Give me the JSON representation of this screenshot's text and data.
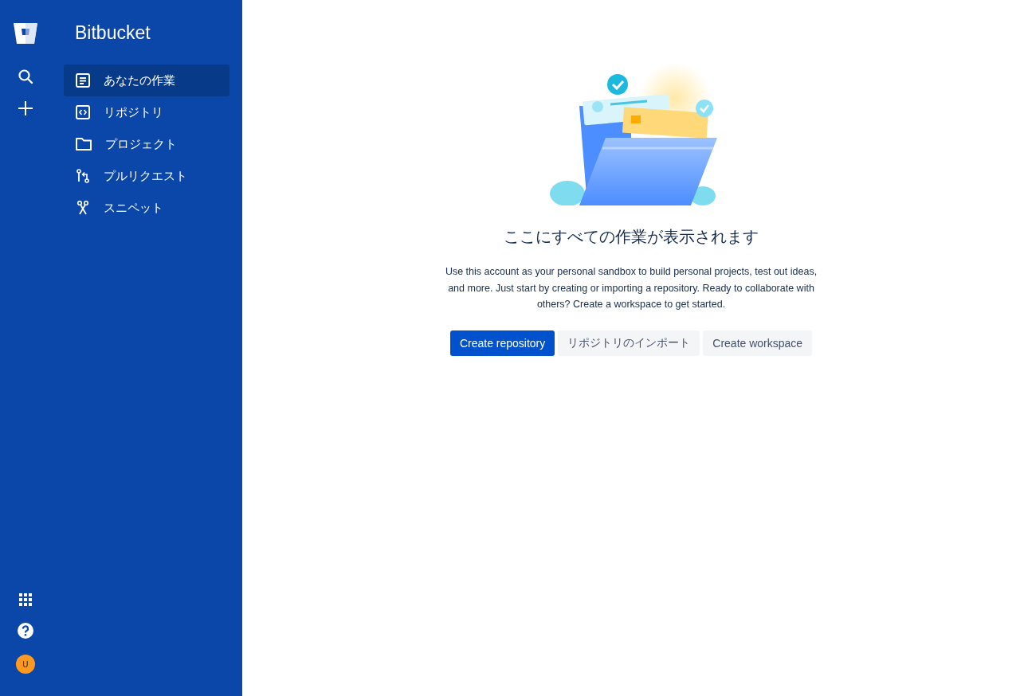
{
  "product": {
    "name": "Bitbucket"
  },
  "nav_items": [
    {
      "label": "あなたの作業",
      "kind": "work",
      "selected": true
    },
    {
      "label": "リポジトリ",
      "kind": "repo",
      "selected": false
    },
    {
      "label": "プロジェクト",
      "kind": "project",
      "selected": false
    },
    {
      "label": "プルリクエスト",
      "kind": "pullrequest",
      "selected": false
    },
    {
      "label": "スニペット",
      "kind": "snippet",
      "selected": false
    }
  ],
  "user": {
    "initial": "U"
  },
  "empty_state": {
    "title": "ここにすべての作業が表示されます",
    "description": "Use this account as your personal sandbox to build personal projects, test out ideas, and more. Just start by creating or importing a repository. Ready to collaborate with others? Create a workspace to get started.",
    "buttons": [
      {
        "label": "Create repository",
        "kind": "primary"
      },
      {
        "label": "リポジトリのインポート",
        "kind": "default"
      },
      {
        "label": "Create workspace",
        "kind": "default"
      }
    ]
  }
}
